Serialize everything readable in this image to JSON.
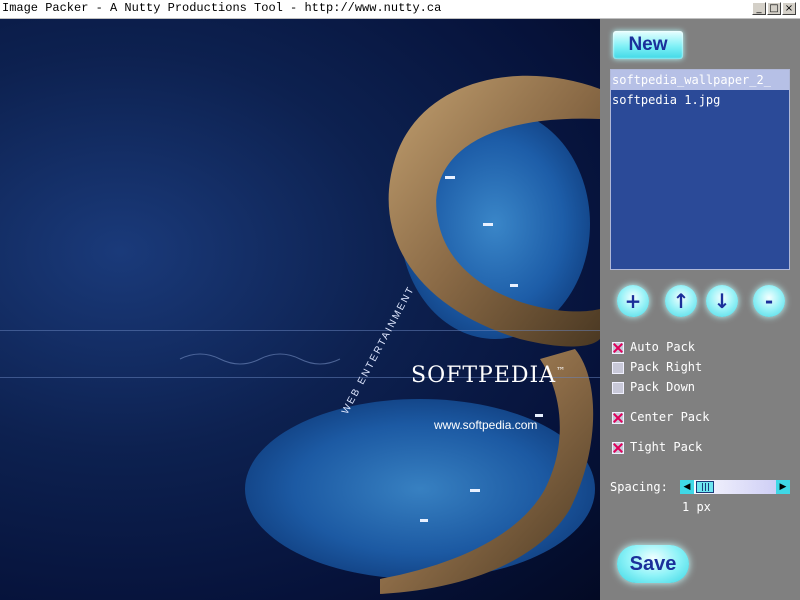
{
  "window": {
    "title": "Image Packer - A Nutty Productions Tool - http://www.nutty.ca",
    "controls": {
      "minimize": "_",
      "maximize": "□",
      "close": "×"
    }
  },
  "preview": {
    "logo_text": "SOFTPEDIA",
    "trademark": "™",
    "url_text": "www.softpedia.com",
    "side_text": "WEB ENTERTAINMENT"
  },
  "panel": {
    "new_label": "New",
    "files": [
      "softpedia_wallpaper_2_",
      "softpedia 1.jpg"
    ],
    "selected_file_index": 0,
    "buttons": {
      "add": "+",
      "move_up": "↑",
      "move_down": "↓",
      "remove": "-"
    },
    "options": [
      {
        "label": "Auto Pack",
        "checked": true
      },
      {
        "label": "Pack Right",
        "checked": false
      },
      {
        "label": "Pack Down",
        "checked": false
      },
      {
        "label": "Center Pack",
        "checked": true
      },
      {
        "label": "Tight Pack",
        "checked": true
      }
    ],
    "spacing": {
      "label": "Spacing:",
      "value_text": "1 px",
      "value": 1
    },
    "save_label": "Save"
  },
  "colors": {
    "accent_cyan": "#7ff0f6",
    "button_text": "#1b2f9a",
    "list_background": "#2b4a98",
    "panel_background": "#808080",
    "check_mark": "#e0005a"
  }
}
